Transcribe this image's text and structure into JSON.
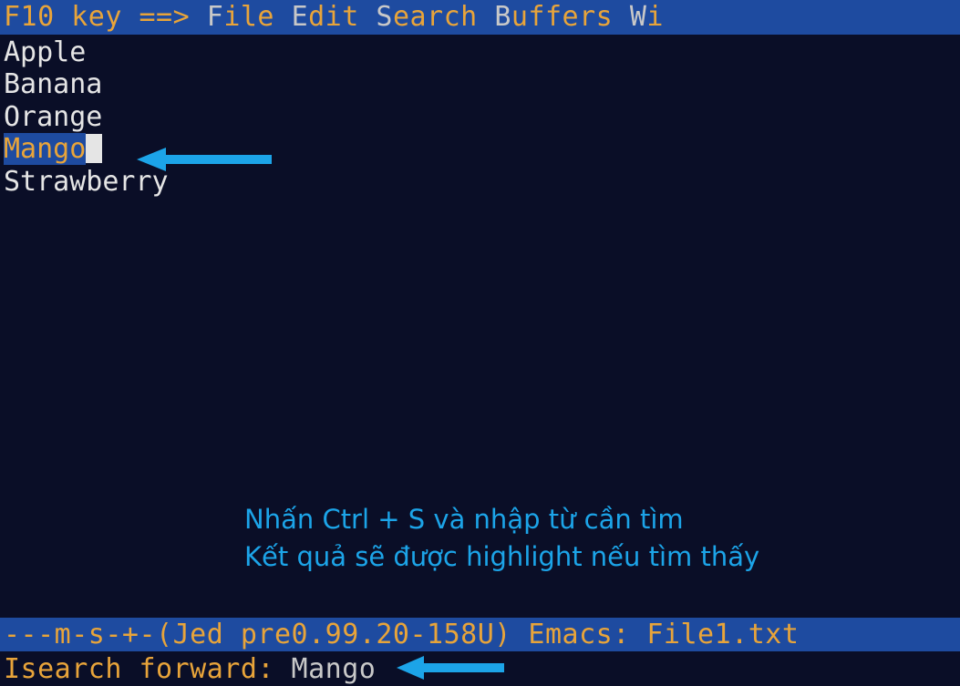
{
  "menubar": {
    "prefix": "F10 key ==>  ",
    "items": [
      {
        "hotkey": "F",
        "rest": "ile"
      },
      {
        "hotkey": "E",
        "rest": "dit"
      },
      {
        "hotkey": "S",
        "rest": "earch"
      },
      {
        "hotkey": "B",
        "rest": "uffers"
      },
      {
        "hotkey": "W",
        "rest": "i"
      }
    ],
    "spacers": [
      "    ",
      "    ",
      "    ",
      "    "
    ]
  },
  "editor": {
    "lines": [
      "Apple",
      "Banana",
      "Orange",
      "Mango",
      "Strawberry"
    ],
    "highlighted_line_index": 3,
    "highlighted_text": "Mango"
  },
  "instructions": {
    "line1": "Nhấn Ctrl + S và nhập từ cần tìm",
    "line2": "Kết quả sẽ được highlight nếu tìm thấy"
  },
  "statusbar": {
    "text": "---m-s-+-(Jed pre0.99.20-158U) Emacs: File1.txt"
  },
  "minibuffer": {
    "prompt": "Isearch forward: ",
    "query": "Mango"
  }
}
